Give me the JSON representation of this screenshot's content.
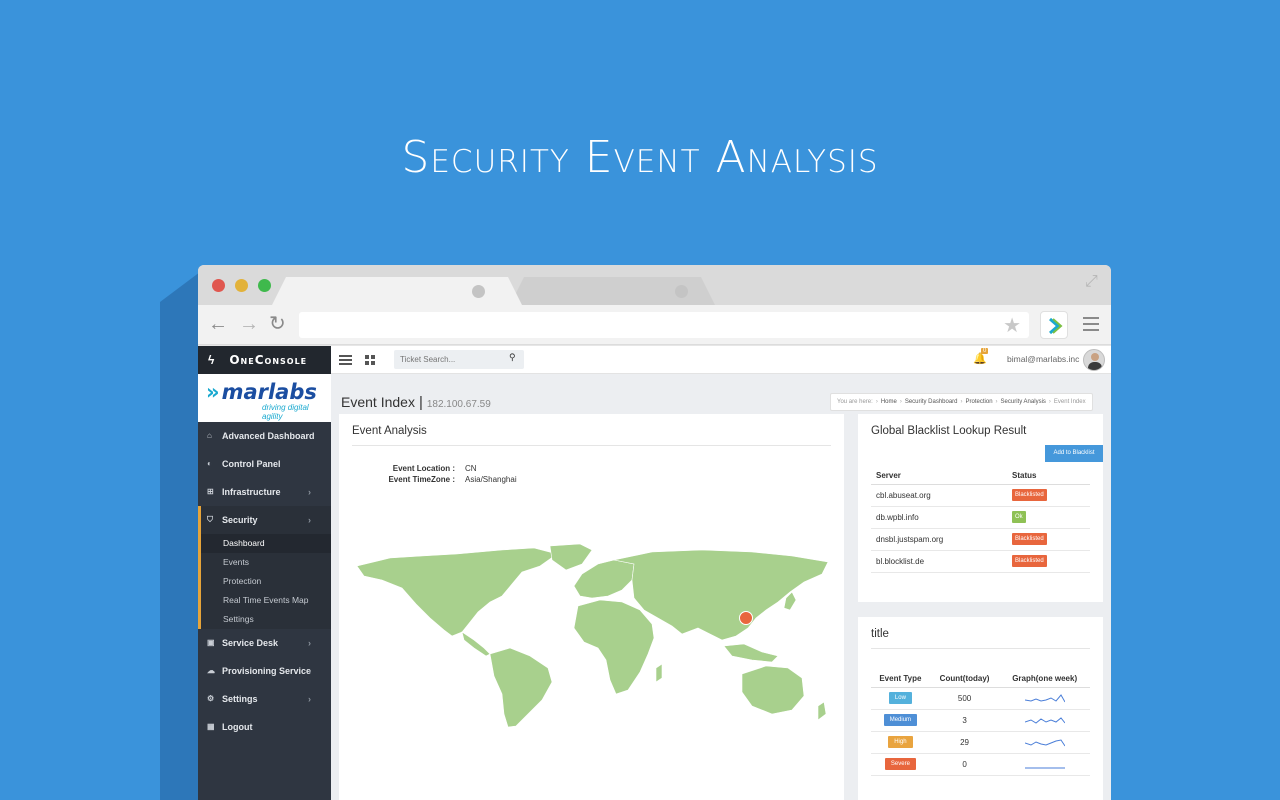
{
  "hero": {
    "title": "Security Event Analysis"
  },
  "browser": {
    "dot_colors": [
      "#e0574f",
      "#e2b23a",
      "#3fb94c"
    ],
    "url": ""
  },
  "app": {
    "brand": "OneConsole",
    "logo": {
      "name": "marlabs",
      "tagline": "driving digital agility"
    },
    "sidebar": {
      "items": [
        {
          "label": "Advanced Dashboard",
          "icon": "home-icon",
          "chevron": false
        },
        {
          "label": "Control Panel",
          "icon": "toggle-icon",
          "chevron": false
        },
        {
          "label": "Infrastructure",
          "icon": "sitemap-icon",
          "chevron": true
        },
        {
          "label": "Security",
          "icon": "shield-icon",
          "chevron": true,
          "active": true
        }
      ],
      "sub_items": [
        "Dashboard",
        "Events",
        "Protection",
        "Real Time Events Map",
        "Settings"
      ],
      "items_after": [
        {
          "label": "Service Desk",
          "icon": "briefcase-icon",
          "chevron": true
        },
        {
          "label": "Provisioning Service",
          "icon": "cloud-icon",
          "chevron": true
        },
        {
          "label": "Settings",
          "icon": "gears-icon",
          "chevron": true
        },
        {
          "label": "Logout",
          "icon": "calendar-icon",
          "chevron": false
        }
      ]
    },
    "topbar": {
      "search_placeholder": "Ticket Search...",
      "notification_count": "0",
      "user_email": "bimal@marlabs.inc"
    },
    "page": {
      "title": "Event Index",
      "ip": "182.100.67.59",
      "breadcrumb": {
        "prefix": "You are here:",
        "items": [
          "Home",
          "Security Dashboard",
          "Protection",
          "Security Analysis"
        ],
        "current": "Event Index"
      }
    },
    "event_analysis": {
      "title": "Event Analysis",
      "location_label": "Event Location :",
      "location_value": "CN",
      "timezone_label": "Event TimeZone :",
      "timezone_value": "Asia/Shanghai",
      "marker_color": "#e8663d"
    },
    "blacklist": {
      "title": "Global Blacklist Lookup Result",
      "add_button": "Add to Blacklist",
      "headers": [
        "Server",
        "Status"
      ],
      "rows": [
        {
          "server": "cbl.abuseat.org",
          "status": "Blacklisted",
          "color": "#e8663d"
        },
        {
          "server": "db.wpbl.info",
          "status": "Ok",
          "color": "#8fc155"
        },
        {
          "server": "dnsbl.justspam.org",
          "status": "Blacklisted",
          "color": "#e8663d"
        },
        {
          "server": "bl.blocklist.de",
          "status": "Blacklisted",
          "color": "#e8663d"
        }
      ]
    },
    "events": {
      "title": "title",
      "headers": [
        "Event Type",
        "Count(today)",
        "Graph(one week)"
      ],
      "rows": [
        {
          "type": "Low",
          "count": "500",
          "color": "#54b1dc"
        },
        {
          "type": "Medium",
          "count": "3",
          "color": "#4e8fd6"
        },
        {
          "type": "High",
          "count": "29",
          "color": "#e9a43f"
        },
        {
          "type": "Severe",
          "count": "0",
          "color": "#e8663d"
        }
      ]
    }
  }
}
